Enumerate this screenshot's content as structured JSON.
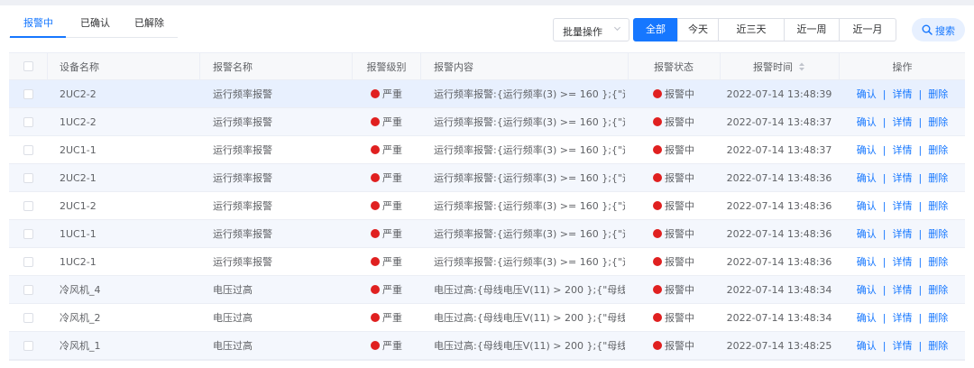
{
  "tabs": [
    {
      "label": "报警中"
    },
    {
      "label": "已确认"
    },
    {
      "label": "已解除"
    }
  ],
  "toolbar": {
    "batch_label": "批量操作",
    "range": [
      "全部",
      "今天",
      "近三天",
      "近一周",
      "近一月"
    ],
    "active_range": "全部",
    "search_label": "搜索"
  },
  "table": {
    "headers": {
      "device": "设备名称",
      "alarm": "报警名称",
      "level": "报警级别",
      "content": "报警内容",
      "status": "报警状态",
      "time": "报警时间",
      "ops": "操作"
    },
    "rows": [
      {
        "device": "2UC2-2",
        "alarm": "运行频率报警",
        "level": "严重",
        "content": "运行频率报警:{运行频率(3) >= 160 };{\"运...",
        "status": "报警中",
        "time": "2022-07-14 13:48:39"
      },
      {
        "device": "1UC2-2",
        "alarm": "运行频率报警",
        "level": "严重",
        "content": "运行频率报警:{运行频率(3) >= 160 };{\"运...",
        "status": "报警中",
        "time": "2022-07-14 13:48:37"
      },
      {
        "device": "2UC1-1",
        "alarm": "运行频率报警",
        "level": "严重",
        "content": "运行频率报警:{运行频率(3) >= 160 };{\"运...",
        "status": "报警中",
        "time": "2022-07-14 13:48:37"
      },
      {
        "device": "2UC2-1",
        "alarm": "运行频率报警",
        "level": "严重",
        "content": "运行频率报警:{运行频率(3) >= 160 };{\"运...",
        "status": "报警中",
        "time": "2022-07-14 13:48:36"
      },
      {
        "device": "2UC1-2",
        "alarm": "运行频率报警",
        "level": "严重",
        "content": "运行频率报警:{运行频率(3) >= 160 };{\"运...",
        "status": "报警中",
        "time": "2022-07-14 13:48:36"
      },
      {
        "device": "1UC1-1",
        "alarm": "运行频率报警",
        "level": "严重",
        "content": "运行频率报警:{运行频率(3) >= 160 };{\"运...",
        "status": "报警中",
        "time": "2022-07-14 13:48:36"
      },
      {
        "device": "1UC2-1",
        "alarm": "运行频率报警",
        "level": "严重",
        "content": "运行频率报警:{运行频率(3) >= 160 };{\"运...",
        "status": "报警中",
        "time": "2022-07-14 13:48:36"
      },
      {
        "device": "冷风机_4",
        "alarm": "电压过高",
        "level": "严重",
        "content": "电压过高:{母线电压V(11) > 200 };{\"母线...",
        "status": "报警中",
        "time": "2022-07-14 13:48:34"
      },
      {
        "device": "冷风机_2",
        "alarm": "电压过高",
        "level": "严重",
        "content": "电压过高:{母线电压V(11) > 200 };{\"母线...",
        "status": "报警中",
        "time": "2022-07-14 13:48:34"
      },
      {
        "device": "冷风机_1",
        "alarm": "电压过高",
        "level": "严重",
        "content": "电压过高:{母线电压V(11) > 200 };{\"母线...",
        "status": "报警中",
        "time": "2022-07-14 13:48:25"
      }
    ],
    "actions": {
      "confirm": "确认",
      "detail": "详情",
      "delete": "删除",
      "separator": "|"
    }
  },
  "colors": {
    "accent": "#1677ff",
    "danger": "#e02020",
    "row_alt": "#f4f7fd",
    "header_bg": "#f7f8fa"
  },
  "icons": {
    "batch_dropdown": "chevron-down-icon",
    "search": "search-icon",
    "sort": "sort-icon",
    "level": "red-dot-icon",
    "status": "red-dot-icon"
  }
}
